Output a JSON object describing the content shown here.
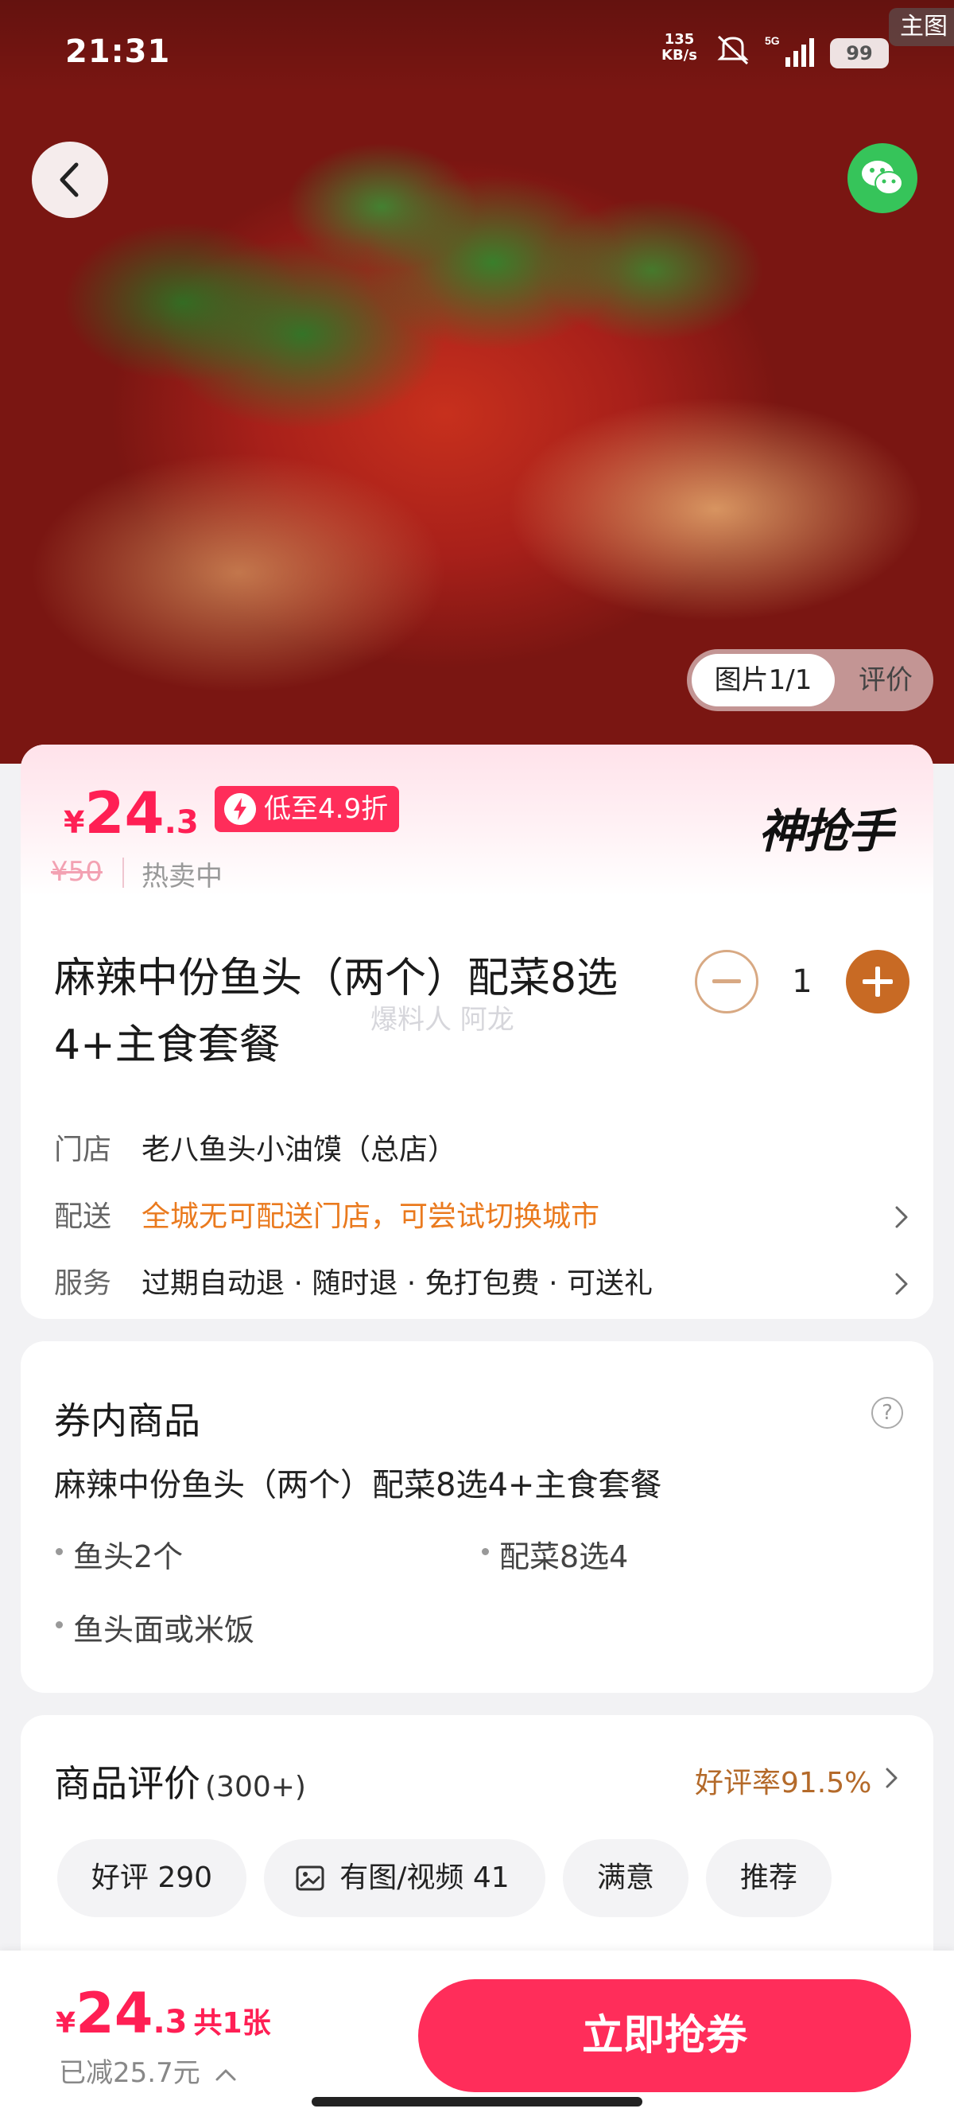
{
  "status_bar": {
    "time": "21:31",
    "net_speed_value": "135",
    "net_speed_unit": "KB/s",
    "network": "5G",
    "battery": "99",
    "corner_label": "主图"
  },
  "gallery": {
    "photo_tab": "图片1/1",
    "review_tab": "评价"
  },
  "product": {
    "price": {
      "currency": "¥",
      "integer": "24",
      "decimal": ".3"
    },
    "discount_badge": "低至4.9折",
    "original_price": "¥50",
    "sale_status": "热卖中",
    "brand": "神抢手",
    "title": "麻辣中份鱼头（两个）配菜8选4+主食套餐",
    "watermark": "爆料人 阿龙",
    "quantity": "1",
    "info": [
      {
        "key": "门店",
        "value": "老八鱼头小油馍（总店）"
      },
      {
        "key": "配送",
        "value": "全城无可配送门店，可尝试切换城市"
      },
      {
        "key": "服务",
        "value": "过期自动退 · 随时退 · 免打包费 · 可送礼"
      }
    ]
  },
  "voucher_contents": {
    "title": "券内商品",
    "help_icon": "?",
    "package_name": "麻辣中份鱼头（两个）配菜8选4+主食套餐",
    "items": [
      "鱼头2个",
      "配菜8选4",
      "鱼头面或米饭"
    ]
  },
  "reviews": {
    "title": "商品评价",
    "count": "(300+)",
    "good_rate": "好评率91.5%",
    "chips": [
      "好评 290",
      "有图/视频 41",
      "满意",
      "推荐"
    ]
  },
  "bottom_bar": {
    "price": {
      "currency": "¥",
      "integer": "24",
      "decimal": ".3"
    },
    "count_label": "共1张",
    "saved_label": "已减25.7元",
    "cta_label": "立即抢券"
  },
  "colors": {
    "brand_red": "#ff2d5a",
    "delivery_warning": "#ea7a1e",
    "stepper_plus": "#c86a24",
    "good_rate": "#b46a2a"
  }
}
